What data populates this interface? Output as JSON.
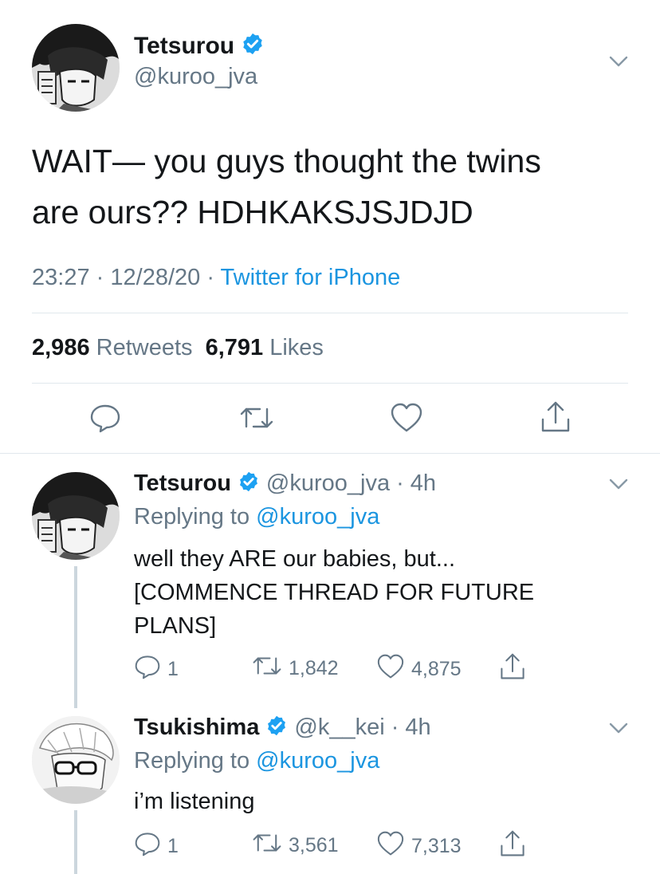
{
  "main_tweet": {
    "display_name": "Tetsurou",
    "handle": "@kuroo_jva",
    "text_line1": "WAIT— you guys thought the twins",
    "text_line2": "are ours?? HDHKAKSJSJDJD",
    "time": "23:27",
    "date": "12/28/20",
    "source": "Twitter for iPhone",
    "separator": "·",
    "retweets_count": "2,986",
    "retweets_label": "Retweets",
    "likes_count": "6,791",
    "likes_label": "Likes"
  },
  "replies": [
    {
      "display_name": "Tetsurou",
      "handle": "@kuroo_jva",
      "age": "· 4h",
      "replying_prefix": "Replying to",
      "replying_to": "@kuroo_jva",
      "text_line1": "well they ARE our babies, but...",
      "text_line2": "[COMMENCE THREAD FOR FUTURE",
      "text_line3": "PLANS]",
      "reply_count": "1",
      "retweet_count": "1,842",
      "like_count": "4,875"
    },
    {
      "display_name": "Tsukishima",
      "handle": "@k__kei",
      "age": "· 4h",
      "replying_prefix": "Replying to",
      "replying_to": "@kuroo_jva",
      "text_line1": "i’m listening",
      "reply_count": "1",
      "retweet_count": "3,561",
      "like_count": "7,313"
    }
  ],
  "colors": {
    "accent": "#1b95e0",
    "text": "#14171a",
    "secondary": "#657786",
    "divider": "#e1e8ed",
    "verified": "#1da1f2"
  },
  "icons": [
    "verified-badge-icon",
    "chevron-down-icon",
    "reply-icon",
    "retweet-icon",
    "like-icon",
    "share-icon"
  ]
}
